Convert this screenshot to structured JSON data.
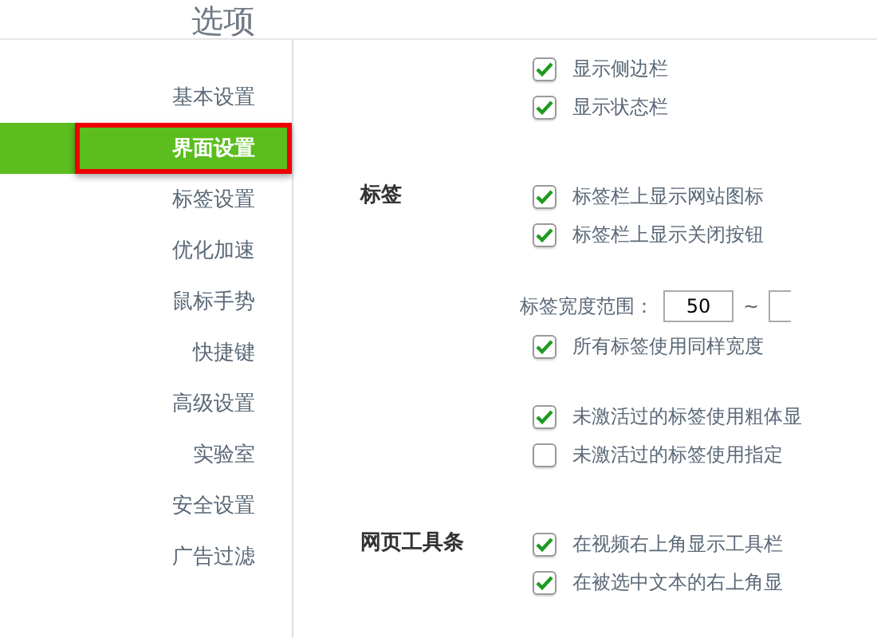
{
  "header": {
    "title": "选项"
  },
  "sidebar": {
    "items": [
      {
        "label": "基本设置",
        "selected": false
      },
      {
        "label": "界面设置",
        "selected": true
      },
      {
        "label": "标签设置",
        "selected": false
      },
      {
        "label": "优化加速",
        "selected": false
      },
      {
        "label": "鼠标手势",
        "selected": false
      },
      {
        "label": "快捷键",
        "selected": false
      },
      {
        "label": "高级设置",
        "selected": false
      },
      {
        "label": "实验室",
        "selected": false
      },
      {
        "label": "安全设置",
        "selected": false
      },
      {
        "label": "广告过滤",
        "selected": false
      }
    ]
  },
  "sections": [
    {
      "groups": [
        [
          {
            "kind": "checkbox",
            "label": "显示侧边栏",
            "checked": true
          },
          {
            "kind": "checkbox",
            "label": "显示状态栏",
            "checked": true
          }
        ]
      ]
    },
    {
      "label": "标签",
      "groups": [
        [
          {
            "kind": "checkbox",
            "label": "标签栏上显示网站图标",
            "checked": true
          },
          {
            "kind": "checkbox",
            "label": "标签栏上显示关闭按钮",
            "checked": true
          }
        ],
        [
          {
            "kind": "range",
            "label": "标签宽度范围：",
            "from": "50",
            "separator": "~"
          },
          {
            "kind": "checkbox",
            "label": "所有标签使用同样宽度",
            "checked": true
          }
        ],
        [
          {
            "kind": "checkbox",
            "label": "未激活过的标签使用粗体显",
            "checked": true
          },
          {
            "kind": "checkbox",
            "label": "未激活过的标签使用指定",
            "checked": false
          }
        ]
      ]
    },
    {
      "label": "网页工具条",
      "groups": [
        [
          {
            "kind": "checkbox",
            "label": "在视频右上角显示工具栏",
            "checked": true
          },
          {
            "kind": "checkbox",
            "label": "在被选中文本的右上角显",
            "checked": true
          }
        ]
      ]
    }
  ]
}
